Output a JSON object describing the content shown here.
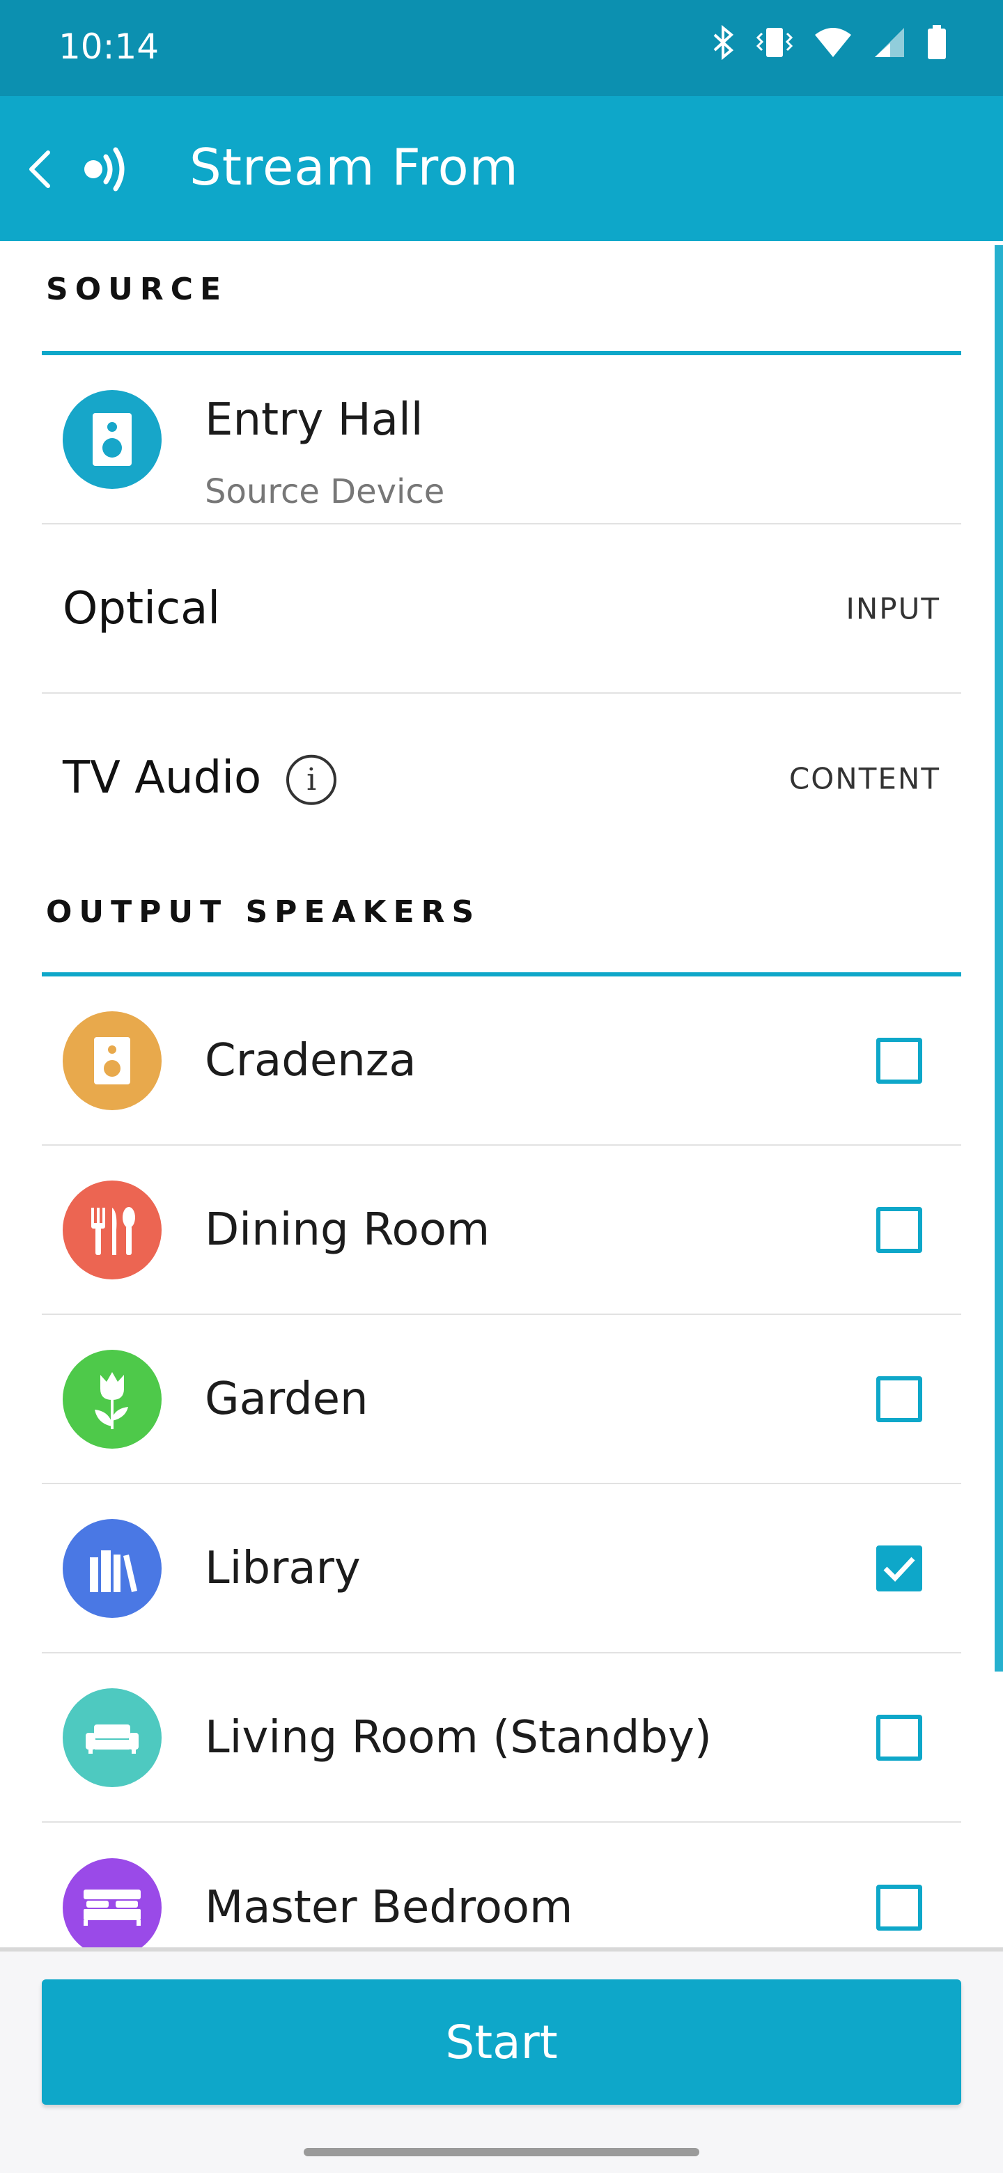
{
  "status_bar": {
    "time": "10:14",
    "icons": [
      "bluetooth-icon",
      "vibrate-icon",
      "wifi-icon",
      "cellular-signal-icon",
      "battery-icon"
    ]
  },
  "app_bar": {
    "title": "Stream From",
    "back_icon": "chevron-left-icon",
    "stream_icon": "stream-broadcast-icon"
  },
  "source_section": {
    "heading": "SOURCE",
    "device": {
      "name": "Entry Hall",
      "subtitle": "Source Device",
      "icon": "speaker-icon",
      "color": "#17a6c9"
    },
    "input": {
      "label": "Optical",
      "tag": "INPUT"
    },
    "content": {
      "label": "TV Audio",
      "tag": "CONTENT",
      "info_icon": "info-icon"
    }
  },
  "output_section": {
    "heading": "OUTPUT SPEAKERS",
    "speakers": [
      {
        "name": "Cradenza",
        "icon": "speaker-icon",
        "color": "#e8a94c",
        "checked": false
      },
      {
        "name": "Dining Room",
        "icon": "utensils-icon",
        "color": "#ec6552",
        "checked": false
      },
      {
        "name": "Garden",
        "icon": "tulip-icon",
        "color": "#4ec94a",
        "checked": false
      },
      {
        "name": "Library",
        "icon": "books-icon",
        "color": "#4a78e4",
        "checked": true
      },
      {
        "name": "Living Room (Standby)",
        "icon": "sofa-icon",
        "color": "#4ec9c0",
        "checked": false
      },
      {
        "name": "Master Bedroom",
        "icon": "bed-icon",
        "color": "#9a4ae8",
        "checked": false
      }
    ]
  },
  "start_button": {
    "label": "Start"
  },
  "accent_color": "#0ea7c9"
}
